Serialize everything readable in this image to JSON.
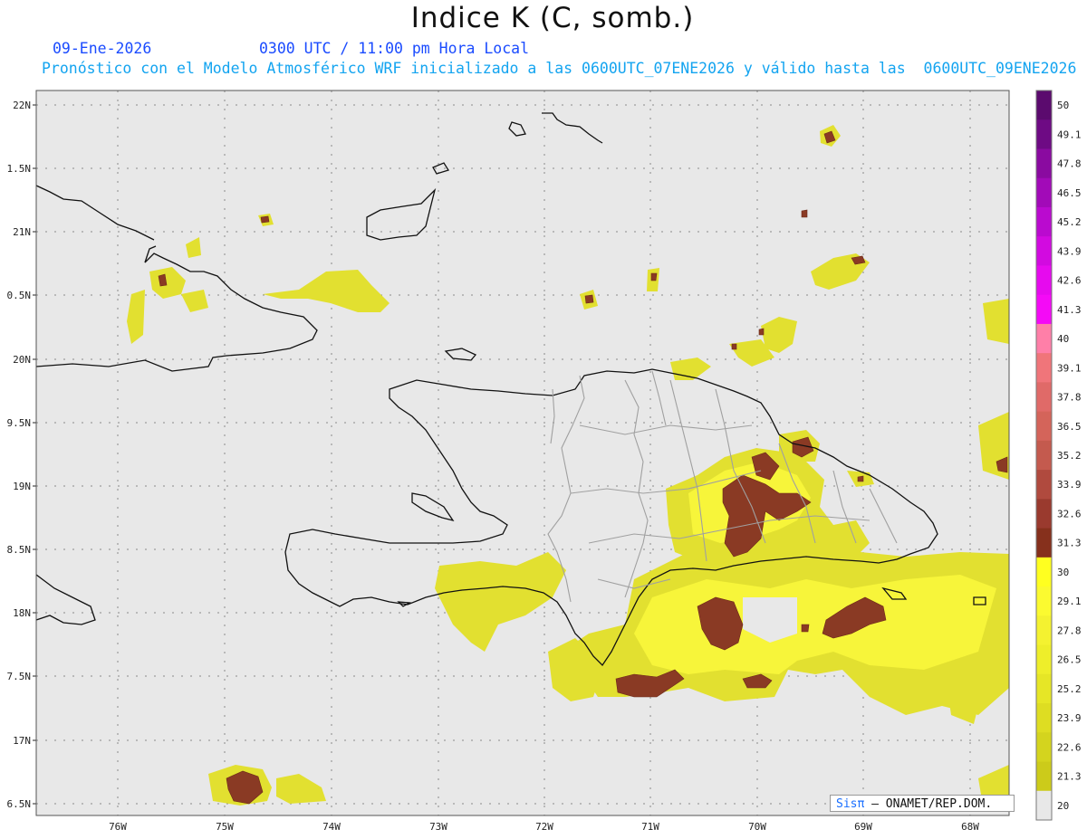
{
  "header": {
    "title": "Indice K (C, somb.)",
    "date": "09-Ene-2026",
    "time": "0300 UTC / 11:00 pm Hora Local",
    "description": "Pronóstico con el Modelo Atmosférico WRF inicializado a las 0600UTC_07ENE2026 y válido hasta las  0600UTC_09ENE2026"
  },
  "axes": {
    "lat_labels": [
      "22N",
      "1.5N",
      "21N",
      "0.5N",
      "20N",
      "9.5N",
      "19N",
      "8.5N",
      "18N",
      "7.5N",
      "17N",
      "6.5N"
    ],
    "lon_labels": [
      "76W",
      "75W",
      "74W",
      "73W",
      "72W",
      "71W",
      "70W",
      "69W",
      "68W"
    ]
  },
  "colorbar": {
    "labels": [
      "50",
      "49.1",
      "47.8",
      "46.5",
      "45.2",
      "43.9",
      "42.6",
      "41.3",
      "40",
      "39.1",
      "37.8",
      "36.5",
      "35.2",
      "33.9",
      "32.6",
      "31.3",
      "30",
      "29.1",
      "27.8",
      "26.5",
      "25.2",
      "23.9",
      "22.6",
      "21.3",
      "20"
    ],
    "colors": [
      "#5b0a6e",
      "#6e0a84",
      "#8a0aa0",
      "#a20ab8",
      "#ba0acf",
      "#d20ae0",
      "#e60aee",
      "#f40af6",
      "#ff7fa8",
      "#f0757a",
      "#e06a68",
      "#d4645a",
      "#c45a4e",
      "#b04a3e",
      "#9a3a2e",
      "#86301c",
      "#ffff20",
      "#fbfa30",
      "#f4f230",
      "#eeee2a",
      "#e6e626",
      "#dedd22",
      "#d4d41e",
      "#cccb1a",
      "#e8e8e8"
    ]
  },
  "credit": {
    "brand": "Sisπ",
    "org": "– ONAMET/REP.DOM."
  }
}
